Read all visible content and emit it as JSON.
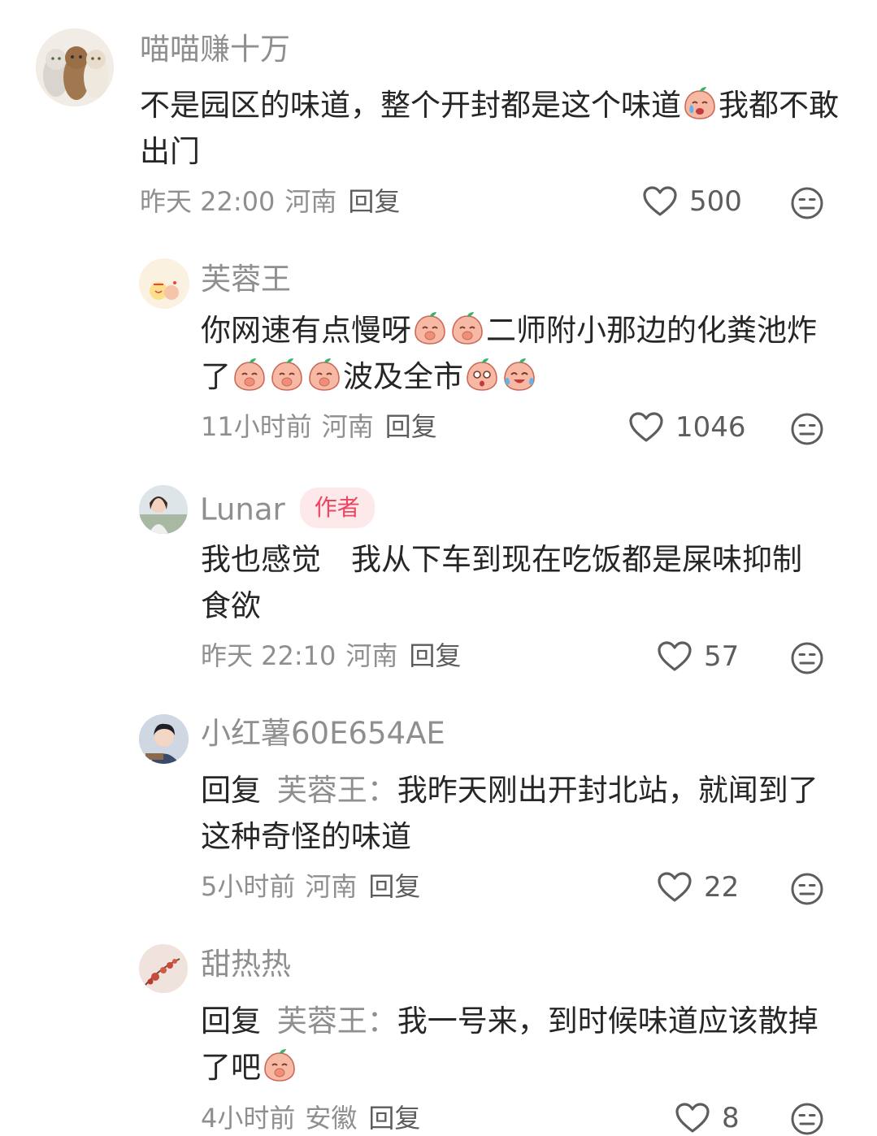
{
  "comments": [
    {
      "username": "喵喵赚十万",
      "text_before": "不是园区的味道，整个开封都是这个味道",
      "text_after": "我都不敢出门",
      "time": "昨天 22:00",
      "location": "河南",
      "reply_label": "回复",
      "likes": "500",
      "emojis": [
        "crying-emoji"
      ]
    },
    {
      "username": "芙蓉王",
      "text_part1": "你网速有点慢呀",
      "text_part2": "二师附小那边的化粪池炸了",
      "text_part3": "波及全市",
      "time": "11小时前",
      "location": "河南",
      "reply_label": "回复",
      "likes": "1046",
      "emojis": [
        "shy-emoji",
        "shy-emoji",
        "shy-emoji",
        "shy-emoji",
        "shy-emoji",
        "shocked-emoji",
        "laugh-cry-emoji"
      ]
    },
    {
      "username": "Lunar",
      "badge": "作者",
      "text": "我也感觉　我从下车到现在吃饭都是屎味抑制食欲",
      "time": "昨天 22:10",
      "location": "河南",
      "reply_label": "回复",
      "likes": "57"
    },
    {
      "username": "小红薯60E654AE",
      "reply_prefix": "回复",
      "mention": "芙蓉王：",
      "text": "我昨天刚出开封北站，就闻到了这种奇怪的味道",
      "time": "5小时前",
      "location": "河南",
      "reply_label": "回复",
      "likes": "22"
    },
    {
      "username": "甜热热",
      "reply_prefix": "回复",
      "mention": "芙蓉王：",
      "text": "我一号来，到时候味道应该散掉了吧",
      "time": "4小时前",
      "location": "安徽",
      "reply_label": "回复",
      "likes": "8",
      "emojis": [
        "shy-emoji"
      ]
    }
  ],
  "icons": {
    "like": "heart-outline-icon",
    "dislike": "unhappy-face-icon"
  },
  "colors": {
    "badge_bg": "#fde8ea",
    "badge_text": "#ec4561",
    "meta": "#8f8f8f"
  }
}
